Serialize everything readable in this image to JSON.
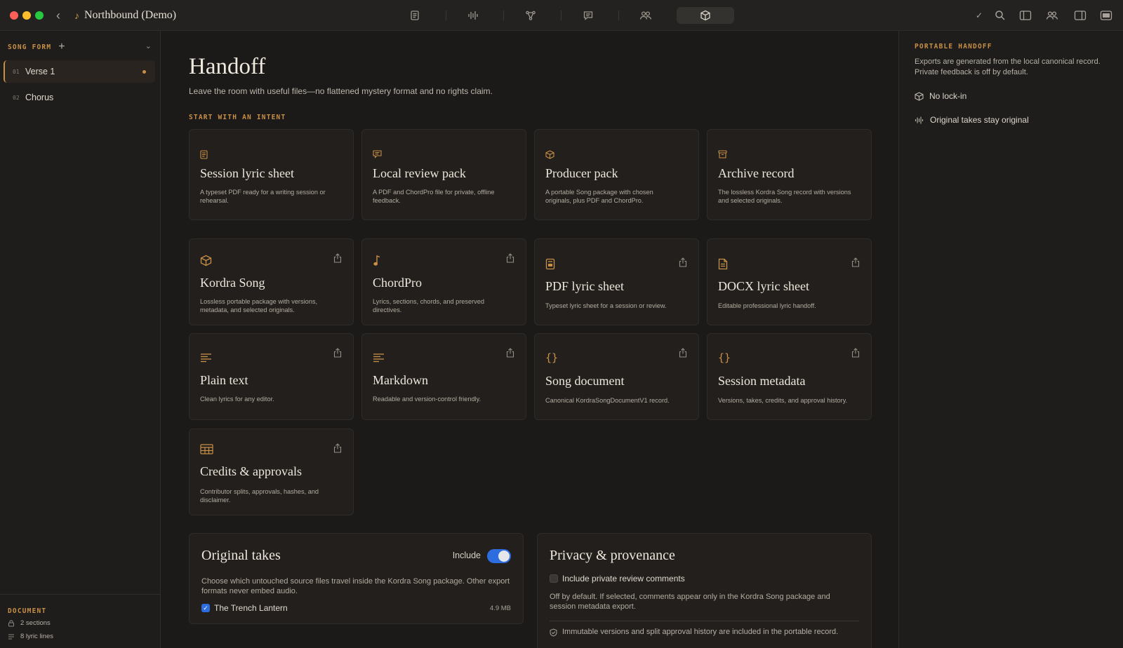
{
  "window": {
    "title": "Northbound (Demo)"
  },
  "sidebar": {
    "header": "SONG FORM",
    "sections": [
      {
        "num": "01",
        "name": "Verse 1"
      },
      {
        "num": "02",
        "name": "Chorus"
      }
    ],
    "document": {
      "label": "DOCUMENT",
      "sections_count": "2 sections",
      "lyric_lines": "8 lyric lines"
    }
  },
  "main": {
    "title": "Handoff",
    "subtitle": "Leave the room with useful files—no flattened mystery format and no rights claim.",
    "intent_label": "START WITH AN INTENT",
    "intents": [
      {
        "title": "Session lyric sheet",
        "desc": "A typeset PDF ready for a writing session or rehearsal.",
        "icon": "document-icon"
      },
      {
        "title": "Local review pack",
        "desc": "A PDF and ChordPro file for private, offline feedback.",
        "icon": "comment-icon"
      },
      {
        "title": "Producer pack",
        "desc": "A portable Song package with chosen originals, plus PDF and ChordPro.",
        "icon": "package-icon"
      },
      {
        "title": "Archive record",
        "desc": "The lossless Kordra Song record with versions and selected originals.",
        "icon": "archive-icon"
      }
    ],
    "formats": [
      {
        "title": "Kordra Song",
        "desc": "Lossless portable package with versions, metadata, and selected originals.",
        "icon": "package-icon"
      },
      {
        "title": "ChordPro",
        "desc": "Lyrics, sections, chords, and preserved directives.",
        "icon": "music-note-icon"
      },
      {
        "title": "PDF lyric sheet",
        "desc": "Typeset lyric sheet for a session or review.",
        "icon": "pdf-icon"
      },
      {
        "title": "DOCX lyric sheet",
        "desc": "Editable professional lyric handoff.",
        "icon": "docx-icon"
      },
      {
        "title": "Plain text",
        "desc": "Clean lyrics for any editor.",
        "icon": "text-lines-icon"
      },
      {
        "title": "Markdown",
        "desc": "Readable and version-control friendly.",
        "icon": "text-lines-icon"
      },
      {
        "title": "Song document",
        "desc": "Canonical KordraSongDocumentV1 record.",
        "icon": "braces-icon"
      },
      {
        "title": "Session metadata",
        "desc": "Versions, takes, credits, and approval history.",
        "icon": "braces-icon"
      },
      {
        "title": "Credits & approvals",
        "desc": "Contributor splits, approvals, hashes, and disclaimer.",
        "icon": "table-icon"
      }
    ],
    "original_takes": {
      "title": "Original takes",
      "include_label": "Include",
      "include_on": true,
      "desc": "Choose which untouched source files travel inside the Kordra Song package. Other export formats never embed audio.",
      "take_name": "The Trench Lantern",
      "take_size": "4.9 MB",
      "take_checked": true
    },
    "privacy": {
      "title": "Privacy & provenance",
      "checkbox_label": "Include private review comments",
      "checkbox_checked": false,
      "desc": "Off by default. If selected, comments appear only in the Kordra Song package and session metadata export.",
      "note": "Immutable versions and split approval history are included in the portable record."
    }
  },
  "right_panel": {
    "label": "PORTABLE HANDOFF",
    "desc": "Exports are generated from the local canonical record. Private feedback is off by default.",
    "items": [
      {
        "label": "No lock-in",
        "icon": "package-icon"
      },
      {
        "label": "Original takes stay original",
        "icon": "waveform-icon"
      }
    ]
  },
  "colors": {
    "accent": "#c88f46",
    "toggle": "#2d6de0",
    "background": "#1b1a19",
    "card": "#221f1d"
  }
}
